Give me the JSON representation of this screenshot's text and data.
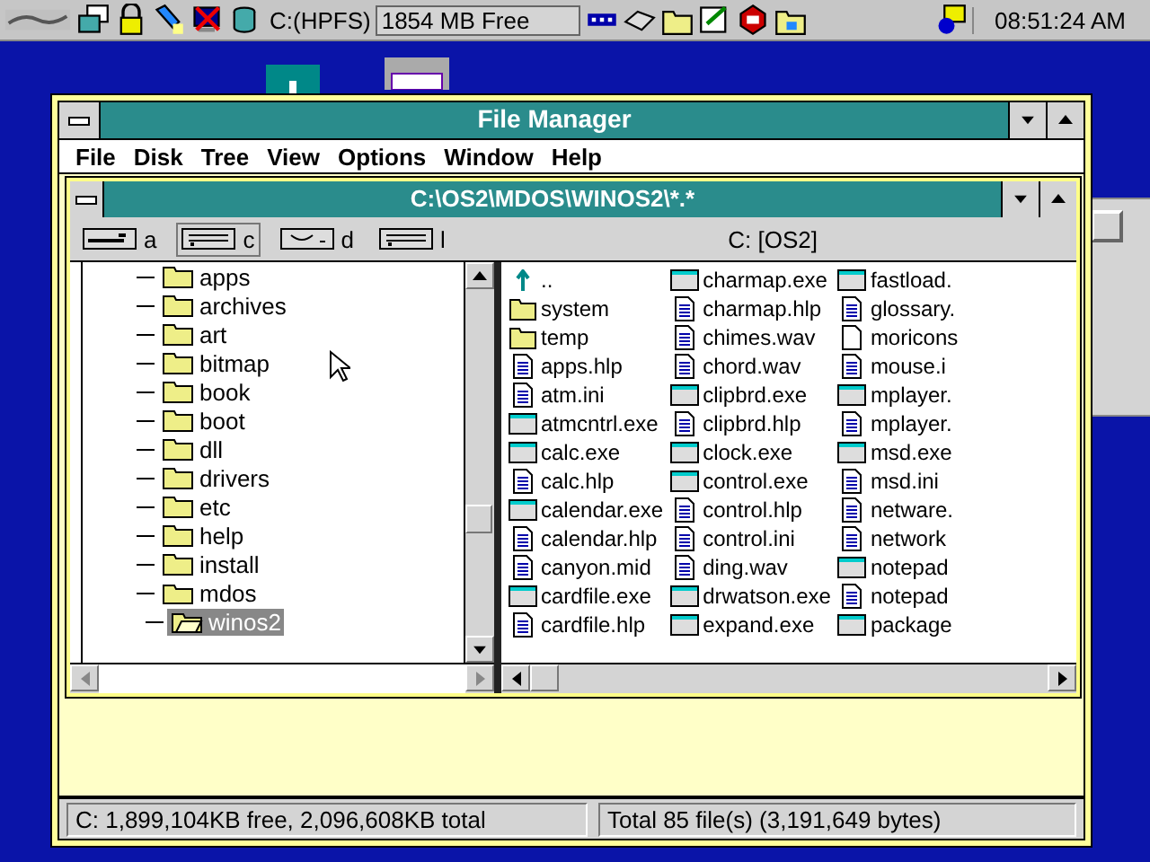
{
  "taskbar": {
    "drive_label": "C:(HPFS)",
    "free_space": "1854 MB Free",
    "clock": "08:51:24 AM"
  },
  "window": {
    "title": "File Manager"
  },
  "menu": [
    "File",
    "Disk",
    "Tree",
    "View",
    "Options",
    "Window",
    "Help"
  ],
  "child": {
    "title": "C:\\OS2\\MDOS\\WINOS2\\*.*",
    "drives": [
      {
        "letter": "a",
        "kind": "floppy",
        "selected": false
      },
      {
        "letter": "c",
        "kind": "hard",
        "selected": true
      },
      {
        "letter": "d",
        "kind": "cdrom",
        "selected": false
      },
      {
        "letter": "l",
        "kind": "hard",
        "selected": false
      }
    ],
    "volume": "C: [OS2]",
    "tree": [
      {
        "name": "apps",
        "selected": false
      },
      {
        "name": "archives",
        "selected": false
      },
      {
        "name": "art",
        "selected": false
      },
      {
        "name": "bitmap",
        "selected": false
      },
      {
        "name": "book",
        "selected": false
      },
      {
        "name": "boot",
        "selected": false
      },
      {
        "name": "dll",
        "selected": false
      },
      {
        "name": "drivers",
        "selected": false
      },
      {
        "name": "etc",
        "selected": false
      },
      {
        "name": "help",
        "selected": false
      },
      {
        "name": "install",
        "selected": false
      },
      {
        "name": "mdos",
        "selected": false,
        "children": [
          {
            "name": "winos2",
            "selected": true
          }
        ]
      }
    ],
    "files": [
      {
        "name": "..",
        "kind": "up"
      },
      {
        "name": "system",
        "kind": "folder"
      },
      {
        "name": "temp",
        "kind": "folder"
      },
      {
        "name": "apps.hlp",
        "kind": "doc"
      },
      {
        "name": "atm.ini",
        "kind": "doc"
      },
      {
        "name": "atmcntrl.exe",
        "kind": "exe"
      },
      {
        "name": "calc.exe",
        "kind": "exe"
      },
      {
        "name": "calc.hlp",
        "kind": "doc"
      },
      {
        "name": "calendar.exe",
        "kind": "exe"
      },
      {
        "name": "calendar.hlp",
        "kind": "doc"
      },
      {
        "name": "canyon.mid",
        "kind": "doc"
      },
      {
        "name": "cardfile.exe",
        "kind": "exe"
      },
      {
        "name": "cardfile.hlp",
        "kind": "doc"
      },
      {
        "name": "charmap.exe",
        "kind": "exe"
      },
      {
        "name": "charmap.hlp",
        "kind": "doc"
      },
      {
        "name": "chimes.wav",
        "kind": "doc"
      },
      {
        "name": "chord.wav",
        "kind": "doc"
      },
      {
        "name": "clipbrd.exe",
        "kind": "exe"
      },
      {
        "name": "clipbrd.hlp",
        "kind": "doc"
      },
      {
        "name": "clock.exe",
        "kind": "exe"
      },
      {
        "name": "control.exe",
        "kind": "exe"
      },
      {
        "name": "control.hlp",
        "kind": "doc"
      },
      {
        "name": "control.ini",
        "kind": "doc"
      },
      {
        "name": "ding.wav",
        "kind": "doc"
      },
      {
        "name": "drwatson.exe",
        "kind": "exe"
      },
      {
        "name": "expand.exe",
        "kind": "exe"
      },
      {
        "name": "fastload.",
        "kind": "exe"
      },
      {
        "name": "glossary.",
        "kind": "doc"
      },
      {
        "name": "moricons",
        "kind": "blank"
      },
      {
        "name": "mouse.i",
        "kind": "doc"
      },
      {
        "name": "mplayer.",
        "kind": "exe"
      },
      {
        "name": "mplayer.",
        "kind": "doc"
      },
      {
        "name": "msd.exe",
        "kind": "exe"
      },
      {
        "name": "msd.ini",
        "kind": "doc"
      },
      {
        "name": "netware.",
        "kind": "doc"
      },
      {
        "name": "network",
        "kind": "doc"
      },
      {
        "name": "notepad",
        "kind": "exe"
      },
      {
        "name": "notepad",
        "kind": "doc"
      },
      {
        "name": "package",
        "kind": "exe"
      }
    ]
  },
  "status": [
    "C: 1,899,104KB free,  2,096,608KB total",
    "Total 85 file(s) (3,191,649 bytes)"
  ]
}
